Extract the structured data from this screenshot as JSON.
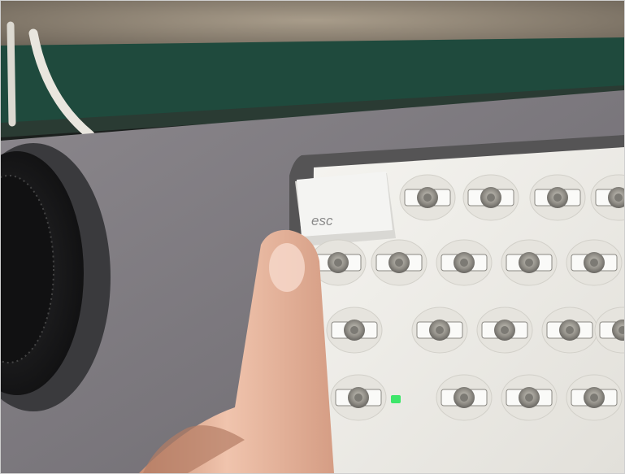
{
  "photo": {
    "esc_key_label": "esc",
    "colors": {
      "carpet": "#8c8274",
      "green_ledge": "#1f4a3d",
      "desk_surface": "#77747a",
      "keyboard_tray": "#efeeea",
      "keycap": "#f2f2f2",
      "led": "#3ee66a",
      "skin": "#e7b8a1"
    }
  }
}
